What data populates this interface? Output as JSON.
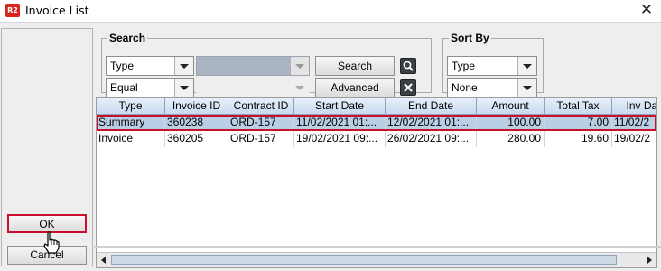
{
  "window": {
    "icon_text": "R2",
    "title": "Invoice List",
    "close_glyph": "✕"
  },
  "left": {
    "ok_label": "OK",
    "cancel_label": "Cancel"
  },
  "search": {
    "legend": "Search",
    "field_value": "Type",
    "operator_value": "Equal",
    "value_text": "",
    "search_label": "Search",
    "advanced_label": "Advanced",
    "search_icon": "search-icon",
    "clear_icon": "clear-x-icon"
  },
  "sort": {
    "legend": "Sort By",
    "primary_value": "Type",
    "secondary_value": "None"
  },
  "table": {
    "columns": [
      "Type",
      "Invoice ID",
      "Contract ID",
      "Start Date",
      "End Date",
      "Amount",
      "Total Tax",
      "Inv Dat"
    ],
    "rows": [
      [
        "Summary",
        "360238",
        "ORD-157",
        "11/02/2021 01:...",
        "12/02/2021 01:...",
        "100.00",
        "7.00",
        "11/02/2"
      ],
      [
        "Invoice",
        "360205",
        "ORD-157",
        "19/02/2021 09:...",
        "26/02/2021 09:...",
        "280.00",
        "19.60",
        "19/02/2"
      ]
    ],
    "selected_row": 0
  },
  "colors": {
    "selection": "#b8cfe5",
    "highlight_outline": "#c8102e",
    "header_gradient_top": "#e9f1fb",
    "header_gradient_bottom": "#c9daf0"
  }
}
